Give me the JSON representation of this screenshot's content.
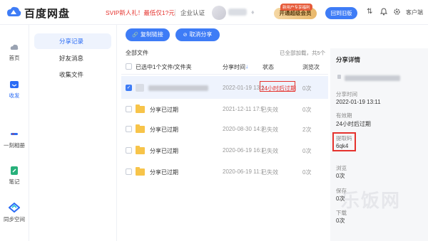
{
  "header": {
    "logo_text": "百度网盘",
    "promo": "SVIP新人礼！最低仅1?元",
    "cert_label": "企业认证",
    "vip_tag": "新用户专享福利",
    "vip_button": "开通超级会员",
    "old_version_button": "回到旧版",
    "client_label": "客户端"
  },
  "rail": {
    "items": [
      {
        "label": "首页"
      },
      {
        "label": "收发"
      },
      {
        "label": "一刻相册"
      },
      {
        "label": "笔记"
      },
      {
        "label": "同步空间"
      }
    ]
  },
  "subnav": {
    "items": [
      {
        "label": "分享记录"
      },
      {
        "label": "好友消息"
      },
      {
        "label": "收集文件"
      }
    ]
  },
  "toolbar": {
    "copy_link": "复制链接",
    "cancel_share": "取消分享"
  },
  "list": {
    "section_title": "全部文件",
    "loaded_text": "已全部加载，共5个",
    "columns": {
      "name": "已选中1个文件/文件夹",
      "time": "分享时间",
      "status": "状态",
      "views": "浏览次"
    },
    "rows": [
      {
        "name": "",
        "time": "2022-01-19 13:1",
        "status": "24小时后过期",
        "views": "0次"
      },
      {
        "name": "分享已过期",
        "time": "2021-12-11 17:5",
        "status": "已失效",
        "views": "0次"
      },
      {
        "name": "分享已过期",
        "time": "2020-08-30 14:3",
        "status": "已失效",
        "views": "2次"
      },
      {
        "name": "分享已过期",
        "time": "2020-06-19 16:1",
        "status": "已失效",
        "views": "0次"
      },
      {
        "name": "分享已过期",
        "time": "2020-06-19 11:1",
        "status": "已失效",
        "views": "0次"
      }
    ]
  },
  "detail": {
    "title": "分享详情",
    "share_time_label": "分享时间",
    "share_time": "2022-01-19 13:11",
    "validity_label": "有效期",
    "validity": "24小时后过期",
    "code_label": "提取码",
    "code": "6qk4",
    "views_label": "浏览",
    "views": "0次",
    "saves_label": "保存",
    "saves": "0次",
    "downloads_label": "下载",
    "downloads": "0次"
  },
  "watermark": "乐饭网",
  "colors": {
    "accent": "#3e7cf6",
    "danger": "#e5322d",
    "folder": "#f7c44a"
  }
}
